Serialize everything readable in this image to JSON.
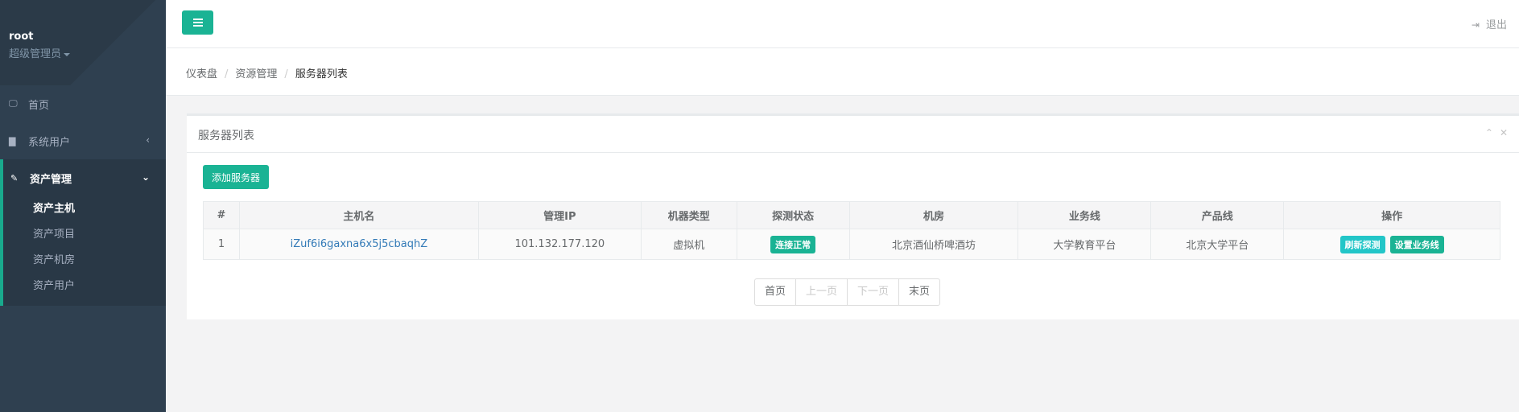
{
  "sidebar": {
    "username": "root",
    "role": "超级管理员",
    "nav": [
      {
        "label": "首页",
        "icon": "laptop-icon"
      },
      {
        "label": "系统用户",
        "icon": "bar-chart-icon"
      }
    ],
    "group": {
      "label": "资产管理",
      "icon": "edit-icon",
      "items": [
        "资产主机",
        "资产项目",
        "资产机房",
        "资产用户"
      ]
    }
  },
  "topbar": {
    "logout_label": "退出"
  },
  "breadcrumb": [
    "仪表盘",
    "资源管理",
    "服务器列表"
  ],
  "panel": {
    "title": "服务器列表",
    "add_button": "添加服务器",
    "table": {
      "headers": [
        "#",
        "主机名",
        "管理IP",
        "机器类型",
        "探测状态",
        "机房",
        "业务线",
        "产品线",
        "操作"
      ],
      "rows": [
        {
          "index": "1",
          "hostname": "iZuf6i6gaxna6x5j5cbaqhZ",
          "ip": "101.132.177.120",
          "type": "虚拟机",
          "status": "连接正常",
          "room": "北京酒仙桥啤酒坊",
          "business": "大学教育平台",
          "product": "北京大学平台",
          "actions": [
            "刷新探测",
            "设置业务线"
          ]
        }
      ]
    },
    "pagination": [
      "首页",
      "上一页",
      "下一页",
      "末页"
    ]
  },
  "colors": {
    "accent": "#1ab394",
    "sidebar": "#2f4050",
    "info": "#23c6c8",
    "link": "#337ab7"
  }
}
